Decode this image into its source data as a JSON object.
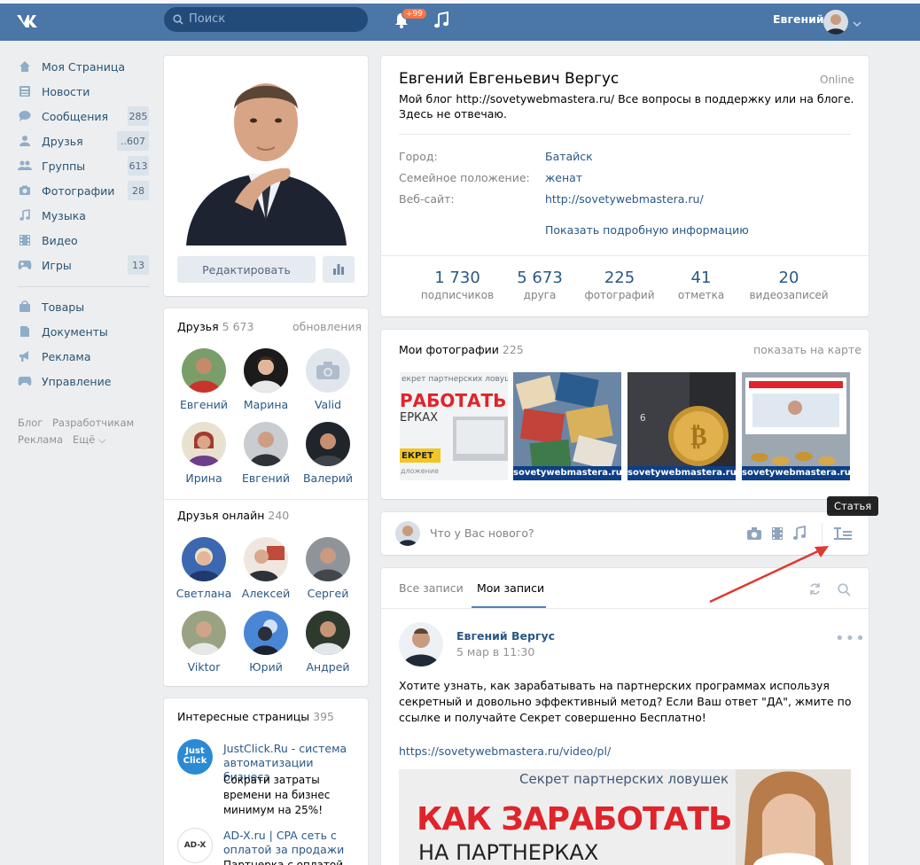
{
  "header": {
    "search_placeholder": "Поиск",
    "notif_badge": "+99",
    "user_name": "Евгений"
  },
  "sidebar": {
    "items": [
      {
        "label": "Моя Страница",
        "count": ""
      },
      {
        "label": "Новости",
        "count": ""
      },
      {
        "label": "Сообщения",
        "count": "285"
      },
      {
        "label": "Друзья",
        "count": "..607"
      },
      {
        "label": "Группы",
        "count": "613"
      },
      {
        "label": "Фотографии",
        "count": "28"
      },
      {
        "label": "Музыка",
        "count": ""
      },
      {
        "label": "Видео",
        "count": ""
      },
      {
        "label": "Игры",
        "count": "13"
      }
    ],
    "items2": [
      {
        "label": "Товары"
      },
      {
        "label": "Документы"
      },
      {
        "label": "Реклама"
      },
      {
        "label": "Управление"
      }
    ],
    "footer": [
      "Блог",
      "Разработчикам",
      "Реклама",
      "Ещё"
    ]
  },
  "profile": {
    "edit_label": "Редактировать",
    "name": "Евгений Евгеньевич Вергус",
    "online": "Online",
    "status_line1": "Мой блог http://sovetywebmastera.ru/ Все вопросы в поддержку или на блоге.",
    "status_line2": "Здесь не отвечаю.",
    "info": [
      {
        "label": "Город:",
        "value": "Батайск"
      },
      {
        "label": "Семейное положение:",
        "value": "женат"
      },
      {
        "label": "Веб-сайт:",
        "value": "http://sovetywebmastera.ru/"
      }
    ],
    "more_info": "Показать подробную информацию",
    "stats": [
      {
        "num": "1 730",
        "label": "подписчиков"
      },
      {
        "num": "5 673",
        "label": "друга"
      },
      {
        "num": "225",
        "label": "фотографий"
      },
      {
        "num": "41",
        "label": "отметка"
      },
      {
        "num": "20",
        "label": "видеозаписей"
      }
    ]
  },
  "friends": {
    "title": "Друзья",
    "count": "5 673",
    "updates": "обновления",
    "list": [
      "Евгений",
      "Марина",
      "Valid",
      "Ирина",
      "Евгений",
      "Валерий"
    ]
  },
  "friends_online": {
    "title": "Друзья онлайн",
    "count": "240",
    "list": [
      "Светлана",
      "Алексей",
      "Сергей",
      "Viktor",
      "Юрий",
      "Андрей"
    ]
  },
  "interesting": {
    "title": "Интересные страницы",
    "count": "395",
    "items": [
      {
        "logo": "Just Click",
        "line1": "JustClick.Ru - система",
        "line2": "автоматизации бизнеса",
        "desc1": "Сократи затраты",
        "desc2": "времени на бизнес",
        "desc3": "минимум на 25%!"
      },
      {
        "logo": "AD-X",
        "line1": "AD-X.ru | CPA сеть с",
        "line2": "оплатой за продажи",
        "desc1": "Партнерка с оплатой за"
      }
    ]
  },
  "photos": {
    "title": "Мои фотографии",
    "count": "225",
    "map_link": "показать на карте",
    "caption": "sovetywebmastera.ru",
    "p1_line1": "екрет партнерских ловушек",
    "p1_line2": "РАБОТАТЬ",
    "p1_line3": "ЕРКАХ",
    "p1_line4": "ЕКРЕТ",
    "p1_line5": "дложение"
  },
  "composer": {
    "placeholder": "Что у Вас нового?",
    "tooltip": "Статья"
  },
  "wall": {
    "tab_all": "Все записи",
    "tab_mine": "Мои записи",
    "post": {
      "author": "Евгений Вергус",
      "date": "5 мар в 11:30",
      "text1": "Хотите узнать, как зарабатывать на партнерских программах используя",
      "text2": "секретный и довольно эффективный метод? Если Ваш ответ \"ДА\", жмите по",
      "text3": "ссылке и получайте Секрет совершенно Бесплатно!",
      "link": "https://sovetywebmastera.ru/video/pl/",
      "img_top": "Секрет партнерских ловушек",
      "img_big": "КАК ЗАРАБОТАТЬ",
      "img_sub": "НА ПАРТНЕРКАХ"
    }
  },
  "colors": {
    "header": "#4a76a8",
    "link": "#2a5885",
    "bg": "#edeef0",
    "arrow": "#e0392f"
  }
}
